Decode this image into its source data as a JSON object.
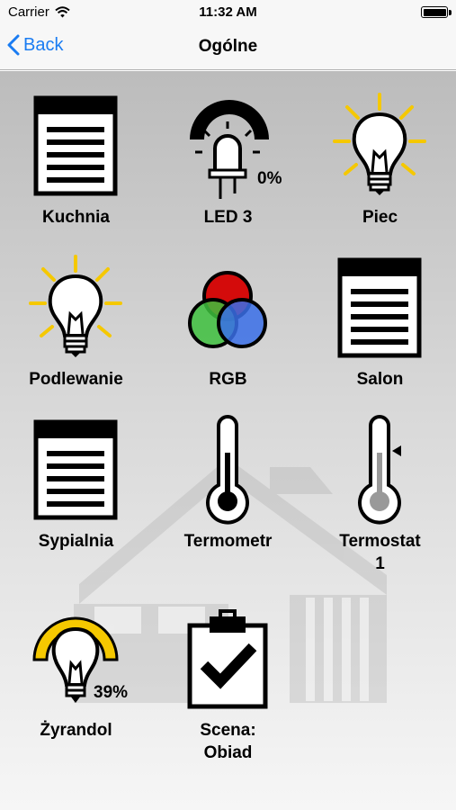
{
  "status_bar": {
    "carrier": "Carrier",
    "time": "11:32 AM"
  },
  "nav": {
    "back_label": "Back",
    "title": "Ogólne"
  },
  "tiles": [
    {
      "label": "Kuchnia"
    },
    {
      "label": "LED 3",
      "value": "0%"
    },
    {
      "label": "Piec"
    },
    {
      "label": "Podlewanie"
    },
    {
      "label": "RGB"
    },
    {
      "label": "Salon"
    },
    {
      "label": "Sypialnia"
    },
    {
      "label": "Termometr"
    },
    {
      "label": "Termostat\n1"
    },
    {
      "label": "Żyrandol",
      "value": "39%"
    },
    {
      "label": "Scena:\nObiad"
    }
  ],
  "colors": {
    "accent": "#1a7cf2",
    "light_on": "#f5c800",
    "rgb_red": "#d40000",
    "rgb_green": "#3dbf3d",
    "rgb_blue": "#3a6fe8"
  }
}
